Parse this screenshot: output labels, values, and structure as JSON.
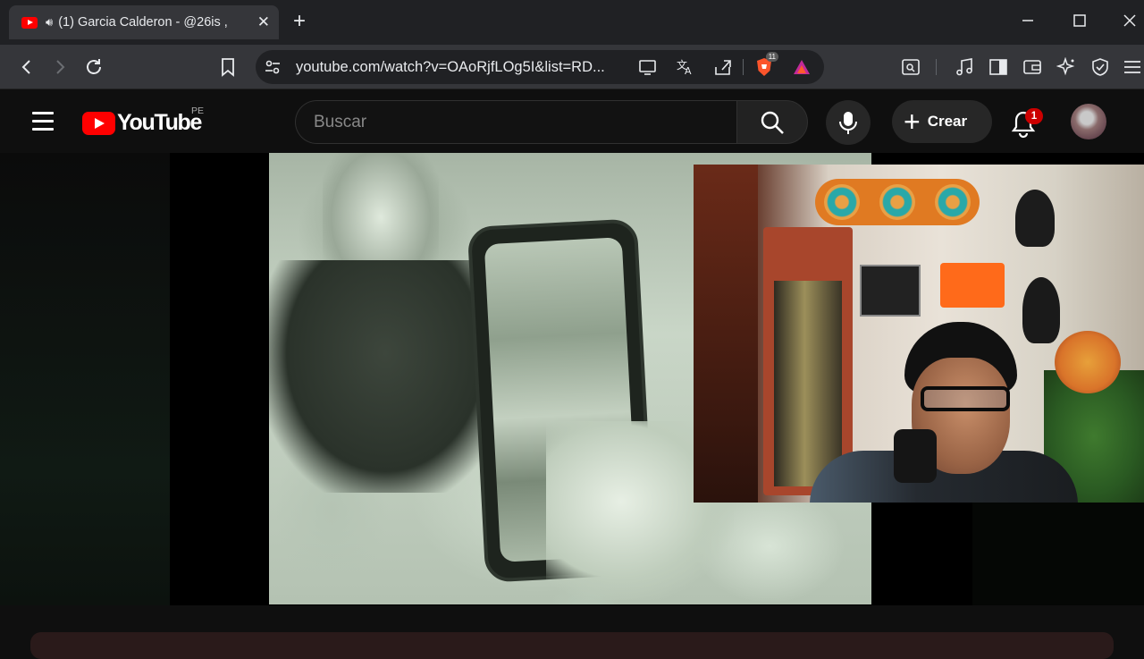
{
  "browser": {
    "tab": {
      "title": "(1) Garcia Calderon - @26is ,",
      "audio_icon": "speaker-icon",
      "favicon": "youtube-favicon"
    },
    "new_tab": "+",
    "address": {
      "url": "youtube.com/watch?v=OAoRjfLOg5I&list=RD..."
    },
    "brave_shields_count": "11",
    "accent_color": "#ff0000"
  },
  "youtube": {
    "logo_text": "YouTube",
    "country_code": "PE",
    "search": {
      "placeholder": "Buscar"
    },
    "create_label": "Crear",
    "notifications_count": "1",
    "brand_color": "#ff0000"
  }
}
